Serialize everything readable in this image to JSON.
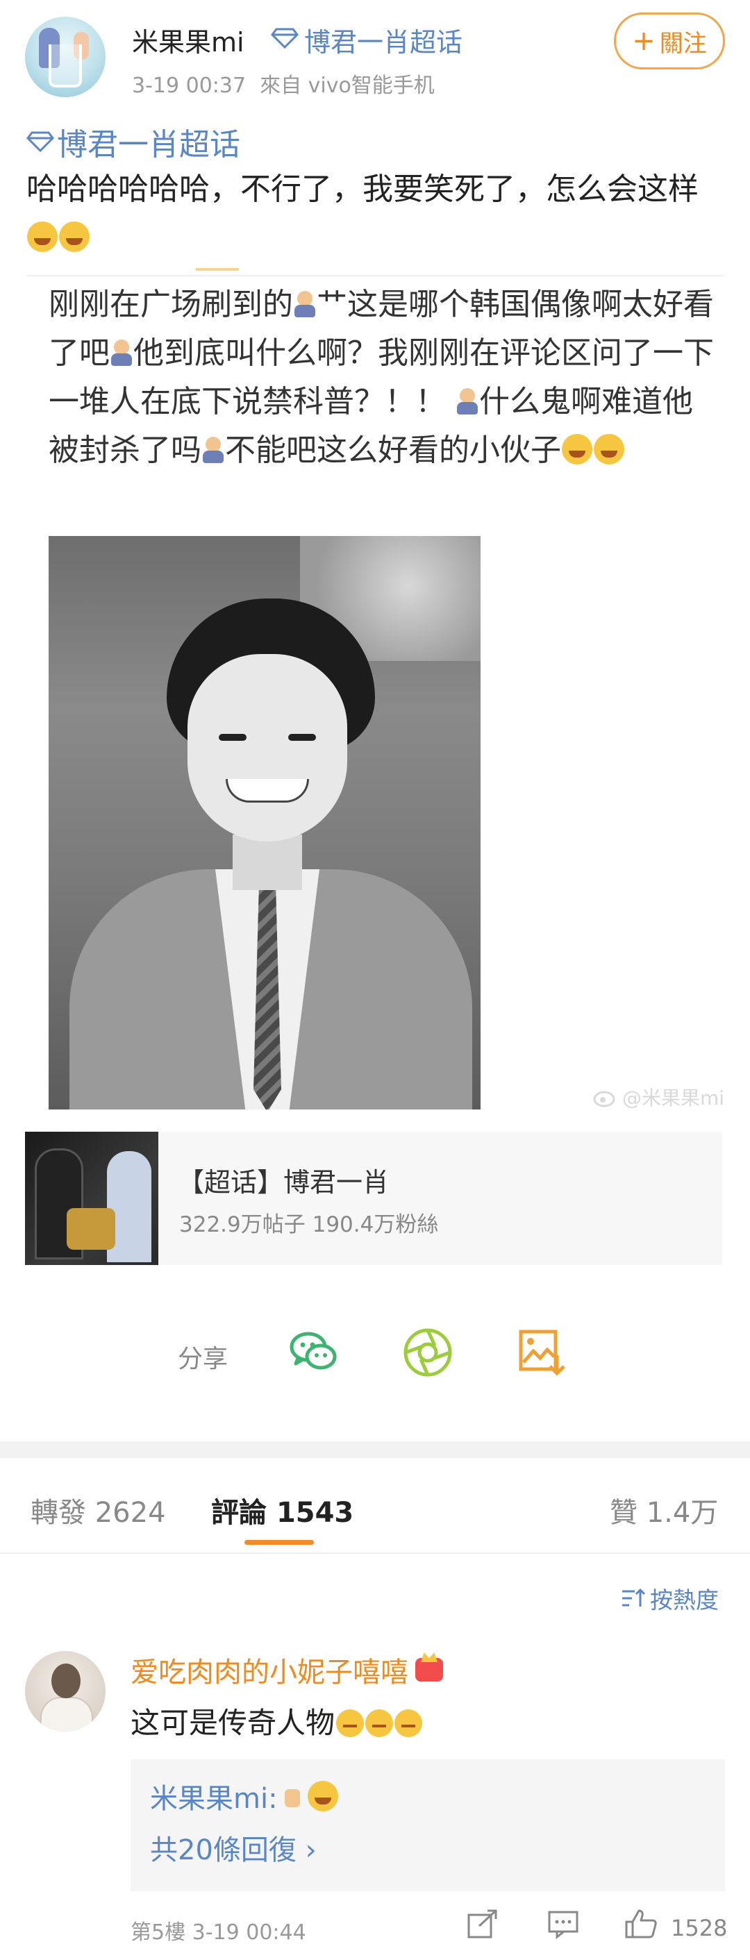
{
  "post": {
    "username": "米果果mi",
    "header_topic": "博君一肖超话",
    "time": "3-19 00:37",
    "source": "來自 vivo智能手机",
    "follow_label": "關注",
    "topic_tag": "博君一肖超话",
    "text": "哈哈哈哈哈哈，不行了，我要笑死了，怎么会这样",
    "emojis": [
      "laugh-cry-emoji",
      "laugh-cry-emoji"
    ]
  },
  "repost": {
    "seg1": "刚刚在广场刷到的",
    "seg2": "艹这是哪个韩国偶像啊太好看了吧",
    "seg3": "他到底叫什么啊？我刚刚在评论区问了一下 一堆人在底下说禁科普？！！",
    "seg4": "什么鬼啊难道他被封杀了吗",
    "seg5": "不能吧这么好看的小伙子"
  },
  "watermark": "@米果果mi",
  "topic_card": {
    "title": "【超话】博君一肖",
    "stats": "322.9万帖子 190.4万粉絲"
  },
  "share": {
    "label": "分享",
    "icons": [
      "wechat-icon",
      "moments-icon",
      "save-image-icon"
    ]
  },
  "tabs": {
    "repost_label": "轉發",
    "repost_count": "2624",
    "comment_label": "評論",
    "comment_count": "1543",
    "like_label": "贊",
    "like_count": "1.4万",
    "active": "comments"
  },
  "sort_label": "按熱度",
  "comment": {
    "name": "爱吃肉肉的小妮子嘻嘻",
    "text": "这可是传奇人物",
    "reply_author": "米果果mi:",
    "reply_more": "共20條回復 ›",
    "floor": "第5樓",
    "time": "3-19 00:44",
    "likes": "1528"
  },
  "colors": {
    "accent_orange": "#f08a1f",
    "link_blue": "#5b86c6",
    "text_dark": "#222222",
    "text_gray": "#888888"
  }
}
